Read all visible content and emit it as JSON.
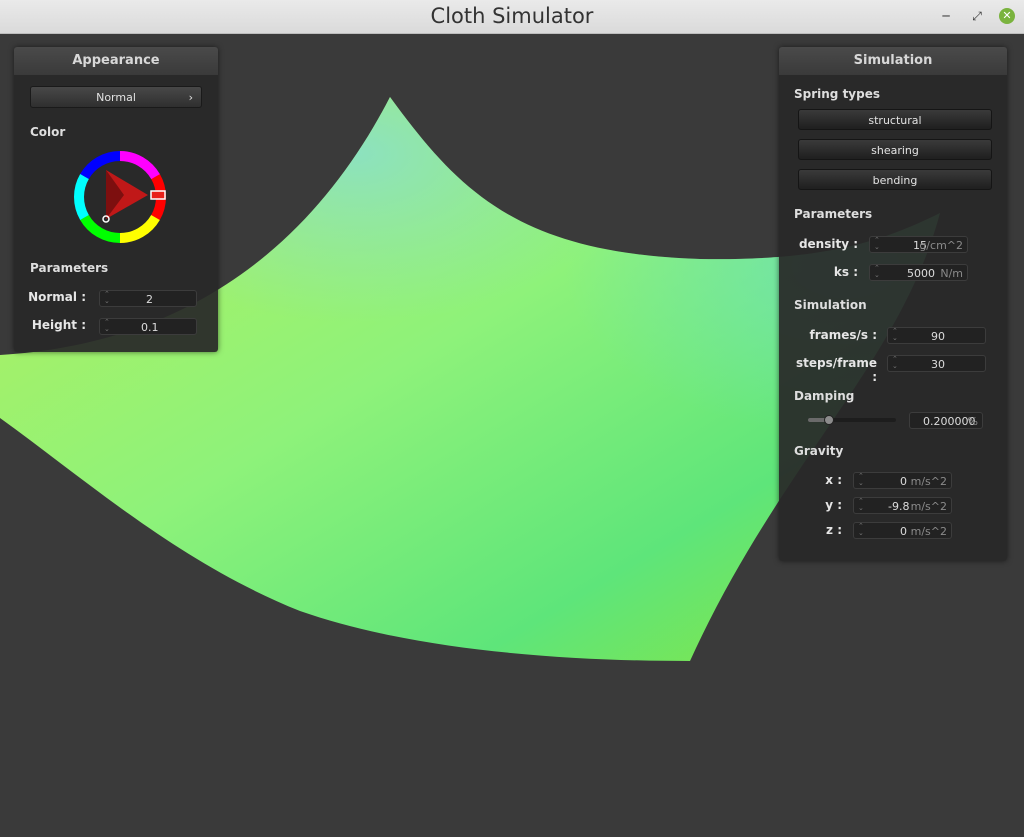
{
  "window": {
    "title": "Cloth Simulator"
  },
  "appearance": {
    "title": "Appearance",
    "shader": "Normal",
    "color_label": "Color",
    "selected_color": "#e8201a",
    "params_label": "Parameters",
    "normal": {
      "label": "Normal :",
      "value": "2"
    },
    "height": {
      "label": "Height :",
      "value": "0.1"
    }
  },
  "simulation": {
    "title": "Simulation",
    "spring_label": "Spring types",
    "springs": [
      "structural",
      "shearing",
      "bending"
    ],
    "params_label": "Parameters",
    "density": {
      "label": "density :",
      "value": "15",
      "unit": "g/cm^2"
    },
    "ks": {
      "label": "ks :",
      "value": "5000",
      "unit": "N/m"
    },
    "sim_label": "Simulation",
    "fps": {
      "label": "frames/s :",
      "value": "90"
    },
    "steps": {
      "label": "steps/frame :",
      "value": "30"
    },
    "damping_label": "Damping",
    "damping": {
      "value": "0.200000",
      "unit": "%",
      "fraction": 0.2
    },
    "gravity_label": "Gravity",
    "gx": {
      "label": "x :",
      "value": "0",
      "unit": "m/s^2"
    },
    "gy": {
      "label": "y :",
      "value": "-9.8",
      "unit": "m/s^2"
    },
    "gz": {
      "label": "z :",
      "value": "0",
      "unit": "m/s^2"
    }
  },
  "colors": {
    "background": "#3a3a3a",
    "cloth": "#7ef06a"
  }
}
